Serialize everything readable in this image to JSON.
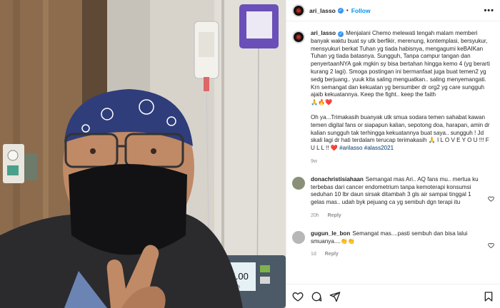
{
  "post": {
    "username": "ari_lasso",
    "verified_mark": "✓",
    "separator": "•",
    "follow_label": "Follow",
    "more_label": "•••",
    "caption_para_1": "Menjalani Chemo melewati tengah malam memberi banyak waktu buat sy utk berfikir, merenung, kontemplasi, bersyukur, mensyukuri berkat Tuhan yg tiada habisnya, mengagumi keBAIKan Tuhan yg tiada batasnya. Sungguh, Tanpa campur tangan dan penyertaanNYA gak mgkin sy bisa bertahan hingga kemo 4 (yg berarti kurang 2 lagi). Smoga postingan ini bermanfaat juga buat temen2 yg sedg berjuang.. yuuk kita saling menguatkan.. saling menyemangati. Krn semangat dan kekuatan yg bersumber dr org2 yg care sungguh ajaib kekuatannya. Keep the fight.. keep the faith",
    "caption_emoji_1": "🙏🔥❤️",
    "caption_para_2": "Oh ya...Trimakasih buanyak utk smua sodara temen sahabat kawan temen digital fans or siapapun kalian, sepotong doa, harapan, amin dr kalian sungguh tak terhingga kekuatannya buat saya.. sungguh ! Jd skali lagi dr hati terdalam terucap terimakasih 🙏 I L O V E Y O U !!! F U L L !! ❤️",
    "hashtags": "#arilasso #alass2021",
    "time": "9w"
  },
  "comments": [
    {
      "username": "donachristisiahaan",
      "text": "Semangat mas Ari.. AQ fans mu.. mertua ku terbebas dari cancer endometrium tanpa kemoterapi konsumsi seduhan 10 lbr daun sirsak ditambah 3 gls air sampai tinggal 1 gelas mas.. udah byk pejuang ca yg sembuh dgn terapi itu",
      "time": "20h",
      "reply_label": "Reply",
      "avatar_color": "#8a8f7a"
    },
    {
      "username": "gugun_le_bon",
      "text": "Semangat mas....pasti sembuh dan bisa lalui smuanya....👏👏",
      "time": "1d",
      "reply_label": "Reply",
      "avatar_color": "#b7b7b7"
    }
  ],
  "photo": {
    "monitor_reading": "104.00",
    "monitor_unit": "ml/h"
  },
  "icons": {
    "like": "heart-icon",
    "comment": "comment-icon",
    "share": "share-icon",
    "save": "bookmark-icon"
  },
  "colors": {
    "accent": "#0095f6",
    "verified": "#3897f0",
    "muted": "#8e8e8e",
    "hashtag": "#00376b"
  }
}
